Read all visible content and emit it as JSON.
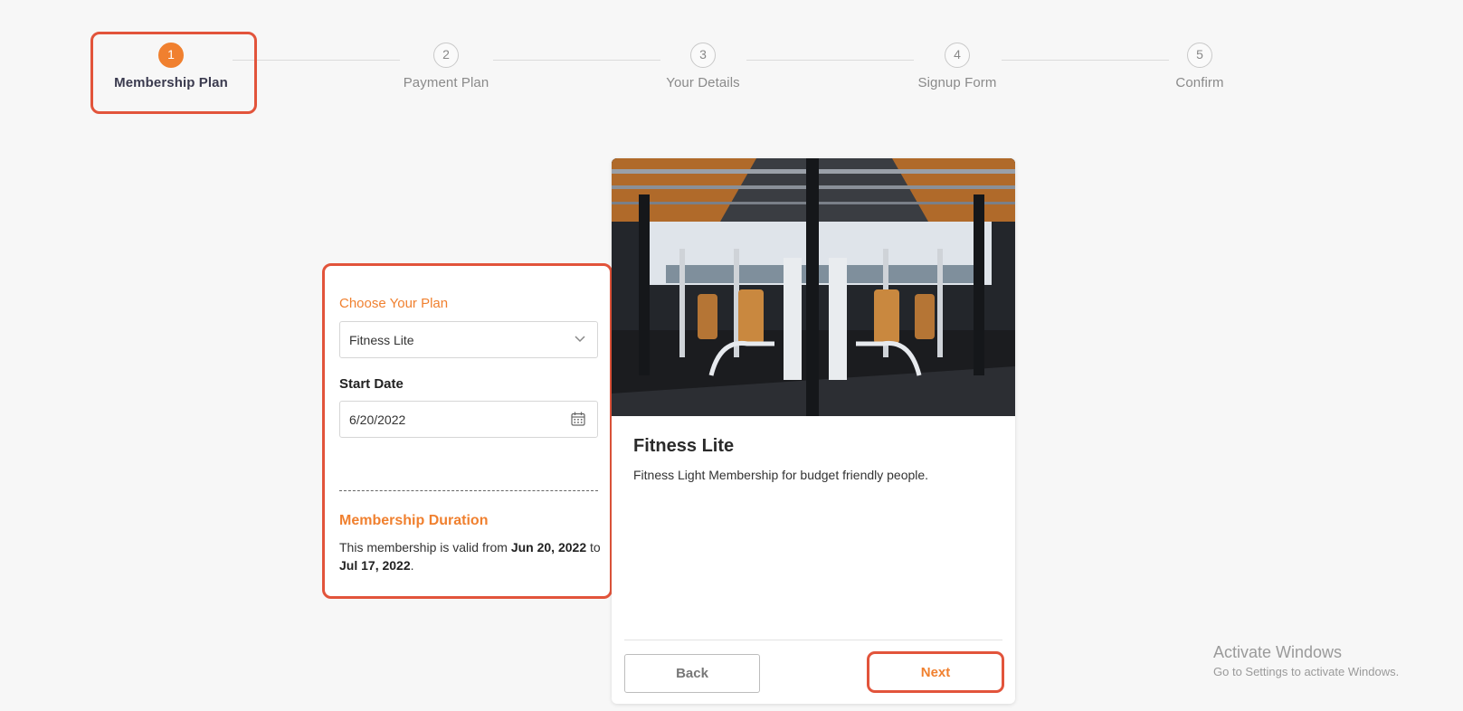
{
  "stepper": {
    "steps": [
      {
        "number": "1",
        "label": "Membership Plan",
        "active": true
      },
      {
        "number": "2",
        "label": "Payment Plan",
        "active": false
      },
      {
        "number": "3",
        "label": "Your Details",
        "active": false
      },
      {
        "number": "4",
        "label": "Signup Form",
        "active": false
      },
      {
        "number": "5",
        "label": "Confirm",
        "active": false
      }
    ]
  },
  "form": {
    "plan_label": "Choose Your Plan",
    "plan_value": "Fitness Lite",
    "start_date_label": "Start Date",
    "start_date_value": "6/20/2022",
    "duration_title": "Membership Duration",
    "duration_prefix": "This membership is valid from ",
    "duration_start": "Jun 20, 2022",
    "duration_mid": " to ",
    "duration_end": "Jul 17, 2022",
    "duration_suffix": "."
  },
  "card": {
    "image_icon": "gym-photo",
    "title": "Fitness Lite",
    "description": "Fitness Light Membership for budget friendly people.",
    "back_label": "Back",
    "next_label": "Next"
  },
  "watermark": {
    "title": "Activate Windows",
    "subtitle": "Go to Settings to activate Windows."
  },
  "colors": {
    "accent": "#f0802f",
    "highlight": "#e2543b",
    "background": "#f7f7f7"
  }
}
